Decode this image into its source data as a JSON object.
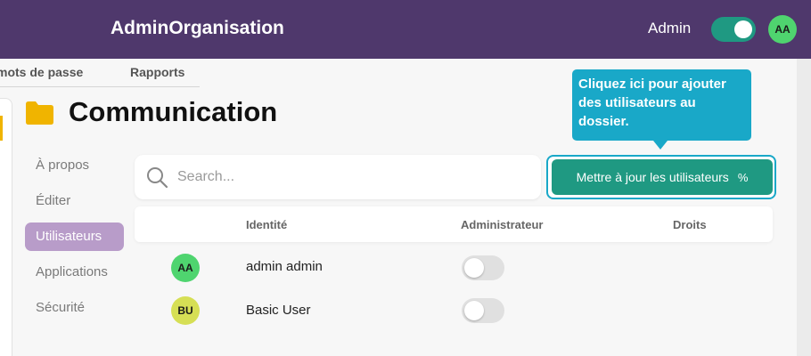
{
  "header": {
    "app_title": "AdminOrganisation",
    "admin_label": "Admin",
    "admin_toggle_on": true,
    "avatar_initials": "AA",
    "avatar_color": "#4fd46f",
    "bar_color": "#4f386c"
  },
  "tabs": [
    {
      "label": "mots de passe"
    },
    {
      "label": "Rapports"
    }
  ],
  "folder": {
    "icon": "folder-icon",
    "icon_color": "#f0b400",
    "title": "Communication"
  },
  "nav": {
    "items": [
      {
        "label": "À propos",
        "active": false
      },
      {
        "label": "Éditer",
        "active": false
      },
      {
        "label": "Utilisateurs",
        "active": true
      },
      {
        "label": "Applications",
        "active": false
      },
      {
        "label": "Sécurité",
        "active": false
      }
    ],
    "active_color": "#b89cc9"
  },
  "search": {
    "placeholder": "Search...",
    "value": "",
    "icon": "search-icon"
  },
  "update_button": {
    "label": "Mettre à jour les utilisateurs",
    "icon_glyph": "%",
    "color": "#1f9982"
  },
  "tooltip": {
    "text": "Cliquez ici pour ajouter des utilisateurs au dossier.",
    "color": "#19a8c8"
  },
  "table": {
    "columns": [
      "Identité",
      "Administrateur",
      "Droits"
    ],
    "rows": [
      {
        "initials": "AA",
        "avatar_color": "#4fd46f",
        "name": "admin admin",
        "is_admin": false
      },
      {
        "initials": "BU",
        "avatar_color": "#d6df55",
        "name": "Basic User",
        "is_admin": false
      }
    ]
  }
}
